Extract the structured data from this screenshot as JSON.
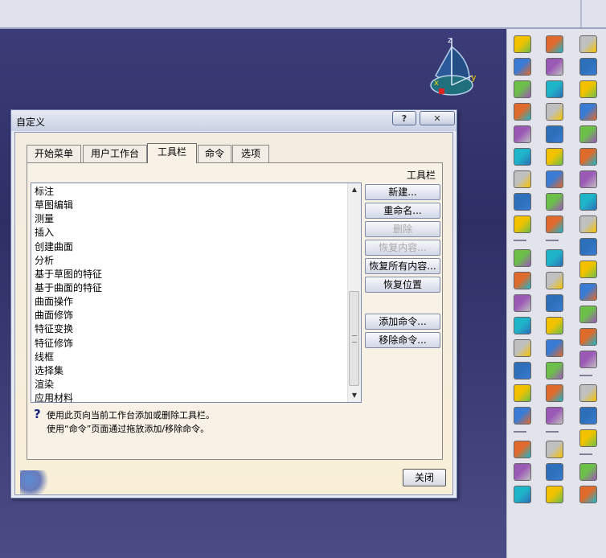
{
  "dialog": {
    "title": "自定义",
    "help_label": "?",
    "close_glyph": "✕",
    "tabs": [
      "开始菜单",
      "用户工作台",
      "工具栏",
      "命令",
      "选项"
    ],
    "active_tab": "工具栏",
    "toolbar_caption": "工具栏",
    "toolbars": [
      "标注",
      "草图编辑",
      "测量",
      "插入",
      "创建曲面",
      "分析",
      "基于草图的特征",
      "基于曲面的特征",
      "曲面操作",
      "曲面修饰",
      "特征变换",
      "特征修饰",
      "线框",
      "选择集",
      "渲染",
      "应用材料"
    ],
    "buttons": {
      "new": "新建...",
      "rename": "重命名...",
      "delete": "删除",
      "restore_contents": "恢复内容...",
      "restore_all": "恢复所有内容...",
      "restore_position": "恢复位置",
      "add_command": "添加命令...",
      "remove_command": "移除命令..."
    },
    "hint_line1": "使用此页向当前工作台添加或删除工具栏。",
    "hint_line2": "使用“命令”页面通过拖放添加/移除命令。",
    "close_label": "关闭"
  },
  "compass": {
    "z": "z",
    "y": "y",
    "x": "x"
  },
  "colors": {
    "background": "#3a3a78",
    "dialog_body": "#f7f1e6",
    "title_bar": "#d6dcec"
  },
  "icons": {
    "col1": [
      "cube-icon",
      "pocket-icon",
      "shaft-icon",
      "groove-icon",
      "hole-icon",
      "rib-icon",
      "slot-icon",
      "stiffener-icon",
      "loft-icon",
      "blank",
      "fillet-icon",
      "chamfer-icon",
      "draft-icon",
      "shell-icon",
      "thickness-icon",
      "thread-icon",
      "split-icon",
      "thick-surface-icon",
      "blank",
      "multi-pad-icon",
      "intersect-icon",
      "surface-icon"
    ],
    "col2": [
      "extrude-surface-icon",
      "revolve-surface-icon",
      "sphere-icon",
      "cylinder-icon",
      "sweep-icon",
      "fill-icon",
      "multi-section-icon",
      "blend-icon",
      "offset-icon",
      "blank",
      "join-icon",
      "healing-icon",
      "untrim-icon",
      "split-surface-icon",
      "trim-icon",
      "boundary-icon",
      "extract-icon",
      "transform-icon",
      "blank",
      "extrapolate-icon",
      "analysis-icon",
      "check-icon"
    ],
    "col3": [
      "hammer-icon",
      "point-icon",
      "line-icon",
      "plane-icon",
      "projection-icon",
      "intersection-icon",
      "parallel-curve-icon",
      "corner-icon",
      "connect-curve-icon",
      "spline-icon",
      "helix-icon",
      "spiral-icon",
      "circle-icon",
      "polyline-icon",
      "sketch-icon",
      "blank",
      "wireframe-icon",
      "axis-icon",
      "grid-icon",
      "blank",
      "repeat-icon",
      "patch-icon"
    ]
  }
}
